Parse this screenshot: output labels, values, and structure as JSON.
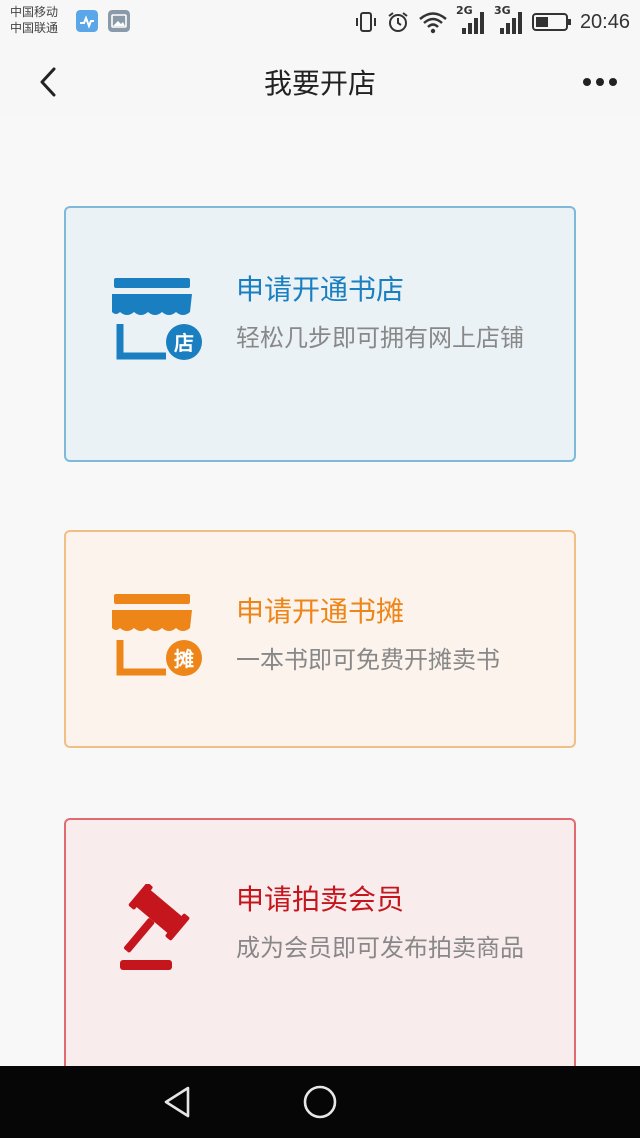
{
  "status_bar": {
    "carrier_1": "中国移动",
    "carrier_2": "中国联通",
    "network_1": "2G",
    "network_2": "3G",
    "time": "20:46",
    "icons": [
      "vibrate-icon",
      "alarm-icon",
      "wifi-icon",
      "signal-2g-icon",
      "signal-3g-icon",
      "battery-icon"
    ]
  },
  "nav": {
    "title": "我要开店",
    "back_icon": "chevron-left-icon",
    "more_icon": "more-icon"
  },
  "cards": [
    {
      "title": "申请开通书店",
      "desc": "轻松几步即可拥有网上店铺",
      "badge": "店",
      "icon": "shop-icon",
      "color": "#1a7fc1"
    },
    {
      "title": "申请开通书摊",
      "desc": "一本书即可免费开摊卖书",
      "badge": "摊",
      "icon": "stall-icon",
      "color": "#ee8518"
    },
    {
      "title": "申请拍卖会员",
      "desc": "成为会员即可发布拍卖商品",
      "icon": "gavel-icon",
      "color": "#c4161c"
    }
  ],
  "system_nav": {
    "back_icon": "nav-back-icon",
    "home_icon": "nav-home-icon"
  }
}
